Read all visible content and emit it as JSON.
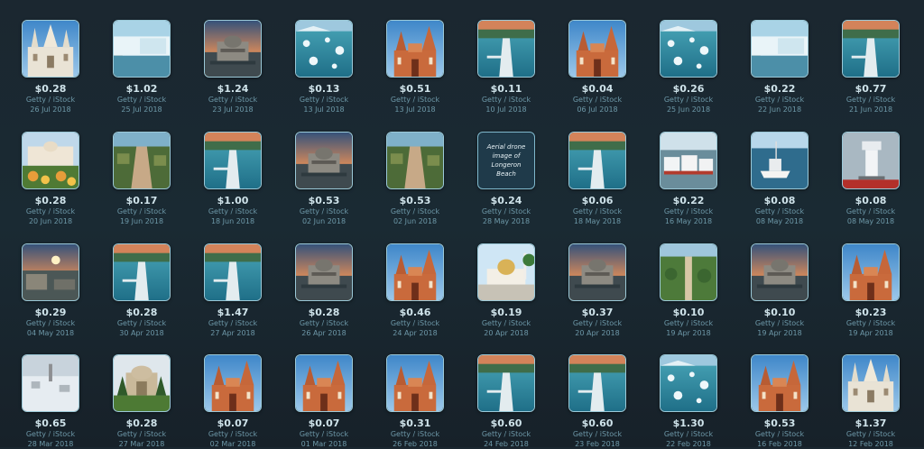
{
  "tiles": [
    {
      "thumb": "church",
      "price": "$0.28",
      "source": "Getty / iStock",
      "date": "26 Jul 2018"
    },
    {
      "thumb": "glacier",
      "price": "$1.02",
      "source": "Getty / iStock",
      "date": "25 Jul 2018"
    },
    {
      "thumb": "opera",
      "price": "$1.24",
      "source": "Getty / iStock",
      "date": "23 Jul 2018"
    },
    {
      "thumb": "ice",
      "price": "$0.13",
      "source": "Getty / iStock",
      "date": "13 Jul 2018"
    },
    {
      "thumb": "redchurch",
      "price": "$0.51",
      "source": "Getty / iStock",
      "date": "13 Jul 2018"
    },
    {
      "thumb": "pier",
      "price": "$0.11",
      "source": "Getty / iStock",
      "date": "10 Jul 2018"
    },
    {
      "thumb": "redchurch",
      "price": "$0.04",
      "source": "Getty / iStock",
      "date": "06 Jul 2018"
    },
    {
      "thumb": "ice",
      "price": "$0.26",
      "source": "Getty / iStock",
      "date": "25 Jun 2018"
    },
    {
      "thumb": "glacier",
      "price": "$0.22",
      "source": "Getty / iStock",
      "date": "22 Jun 2018"
    },
    {
      "thumb": "pier",
      "price": "$0.77",
      "source": "Getty / iStock",
      "date": "21 Jun 2018"
    },
    {
      "thumb": "palace",
      "price": "$0.28",
      "source": "Getty / iStock",
      "date": "20 Jun 2018"
    },
    {
      "thumb": "stairs",
      "price": "$0.17",
      "source": "Getty / iStock",
      "date": "19 Jun 2018"
    },
    {
      "thumb": "pier",
      "price": "$1.00",
      "source": "Getty / iStock",
      "date": "18 Jun 2018"
    },
    {
      "thumb": "opera",
      "price": "$0.53",
      "source": "Getty / iStock",
      "date": "02 Jun 2018"
    },
    {
      "thumb": "stairs",
      "price": "$0.53",
      "source": "Getty / iStock",
      "date": "02 Jun 2018"
    },
    {
      "thumb": "text",
      "text": "Aerial drone image of Longeron Beach",
      "price": "$0.24",
      "source": "Getty / iStock",
      "date": "28 May 2018"
    },
    {
      "thumb": "pier",
      "price": "$0.06",
      "source": "Getty / iStock",
      "date": "18 May 2018"
    },
    {
      "thumb": "boats",
      "price": "$0.22",
      "source": "Getty / iStock",
      "date": "16 May 2018"
    },
    {
      "thumb": "harbor",
      "price": "$0.08",
      "source": "Getty / iStock",
      "date": "08 May 2018"
    },
    {
      "thumb": "lighthouse",
      "price": "$0.08",
      "source": "Getty / iStock",
      "date": "08 May 2018"
    },
    {
      "thumb": "sunset",
      "price": "$0.29",
      "source": "Getty / iStock",
      "date": "04 May 2018"
    },
    {
      "thumb": "pier",
      "price": "$0.28",
      "source": "Getty / iStock",
      "date": "30 Apr 2018"
    },
    {
      "thumb": "pier",
      "price": "$1.47",
      "source": "Getty / iStock",
      "date": "27 Apr 2018"
    },
    {
      "thumb": "opera",
      "price": "$0.28",
      "source": "Getty / iStock",
      "date": "26 Apr 2018"
    },
    {
      "thumb": "redchurch",
      "price": "$0.46",
      "source": "Getty / iStock",
      "date": "24 Apr 2018"
    },
    {
      "thumb": "mosque",
      "price": "$0.19",
      "source": "Getty / iStock",
      "date": "20 Apr 2018"
    },
    {
      "thumb": "opera",
      "price": "$0.37",
      "source": "Getty / iStock",
      "date": "20 Apr 2018"
    },
    {
      "thumb": "park",
      "price": "$0.10",
      "source": "Getty / iStock",
      "date": "19 Apr 2018"
    },
    {
      "thumb": "opera",
      "price": "$0.10",
      "source": "Getty / iStock",
      "date": "19 Apr 2018"
    },
    {
      "thumb": "redchurch",
      "price": "$0.23",
      "source": "Getty / iStock",
      "date": "19 Apr 2018"
    },
    {
      "thumb": "snow",
      "price": "$0.65",
      "source": "Getty / iStock",
      "date": "28 Mar 2018"
    },
    {
      "thumb": "gate",
      "price": "$0.28",
      "source": "Getty / iStock",
      "date": "27 Mar 2018"
    },
    {
      "thumb": "redchurch",
      "price": "$0.07",
      "source": "Getty / iStock",
      "date": "02 Mar 2018"
    },
    {
      "thumb": "redchurch",
      "price": "$0.07",
      "source": "Getty / iStock",
      "date": "01 Mar 2018"
    },
    {
      "thumb": "redchurch",
      "price": "$0.31",
      "source": "Getty / iStock",
      "date": "26 Feb 2018"
    },
    {
      "thumb": "pier",
      "price": "$0.60",
      "source": "Getty / iStock",
      "date": "24 Feb 2018"
    },
    {
      "thumb": "pier",
      "price": "$0.60",
      "source": "Getty / iStock",
      "date": "23 Feb 2018"
    },
    {
      "thumb": "ice",
      "price": "$1.30",
      "source": "Getty / iStock",
      "date": "22 Feb 2018"
    },
    {
      "thumb": "redchurch",
      "price": "$0.53",
      "source": "Getty / iStock",
      "date": "16 Feb 2018"
    },
    {
      "thumb": "church",
      "price": "$1.37",
      "source": "Getty / iStock",
      "date": "12 Feb 2018"
    }
  ]
}
